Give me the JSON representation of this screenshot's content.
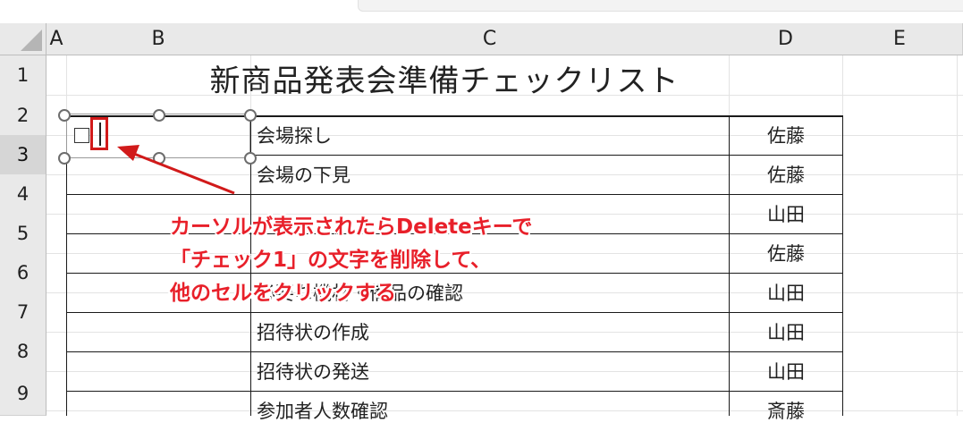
{
  "columns": [
    "A",
    "B",
    "C",
    "D",
    "E"
  ],
  "rows": [
    "1",
    "2",
    "3",
    "4",
    "5",
    "6",
    "7",
    "8",
    "9"
  ],
  "title": "新商品発表会準備チェックリスト",
  "tasks": [
    {
      "task": "会場探し",
      "owner": "佐藤"
    },
    {
      "task": "会場の下見",
      "owner": "佐藤"
    },
    {
      "task": "",
      "owner": "山田"
    },
    {
      "task": "",
      "owner": "佐藤"
    },
    {
      "task": "必要な機材・備品の確認",
      "owner": "山田"
    },
    {
      "task": "招待状の作成",
      "owner": "山田"
    },
    {
      "task": "招待状の発送",
      "owner": "山田"
    },
    {
      "task": "参加者人数確認",
      "owner": "斎藤"
    }
  ],
  "annotation": {
    "line1": "カーソルが表示されたらDeleteキーで",
    "line2": "「チェック1」の文字を削除して、",
    "line3": "他のセルをクリックする",
    "color": "#e8202a"
  },
  "selected_row": "3"
}
